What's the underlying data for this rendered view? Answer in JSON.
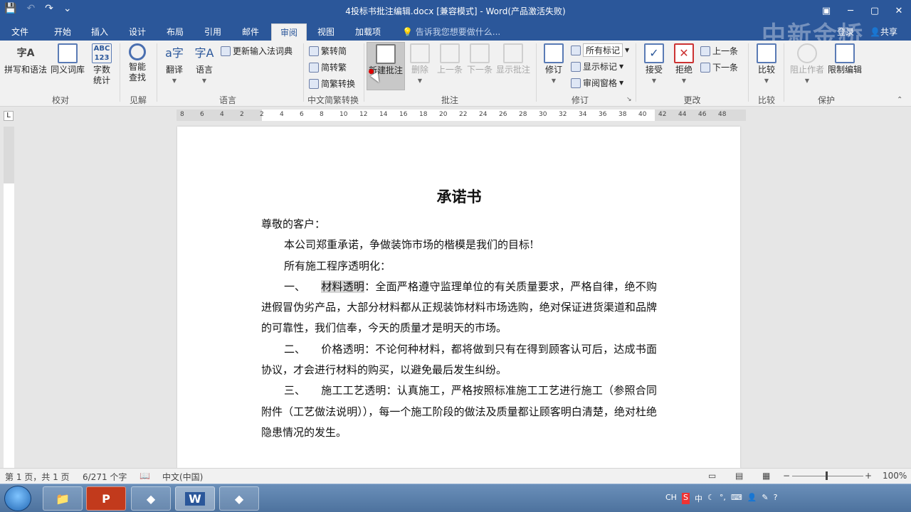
{
  "titlebar": {
    "title": "4投标书批注编辑.docx [兼容模式] - Word(产品激活失败)",
    "save": "💾",
    "undo": "↶",
    "redo": "↷",
    "customize": "⌄",
    "ribbon_opts": "▣",
    "minimize": "─",
    "restore": "▢",
    "close": "✕"
  },
  "tabs": [
    "文件",
    "开始",
    "插入",
    "设计",
    "布局",
    "引用",
    "邮件",
    "审阅",
    "视图",
    "加载项"
  ],
  "active_tab": "审阅",
  "tellme": "告诉我您想要做什么...",
  "signin": "登录",
  "share": "共享",
  "watermark": "中新金桥",
  "ribbon": {
    "spelling": "拼写和语法",
    "thesaurus": "同义词库",
    "wordcount1": "字数",
    "wordcount2": "统计",
    "abc_label": "ABC",
    "abc_num": "123",
    "proofing": "校对",
    "smart1": "智能",
    "smart2": "查找",
    "insights": "见解",
    "translate": "翻译",
    "language": "语言",
    "update_ime": "更新输入法词典",
    "language_group": "语言",
    "t2s": "繁转简",
    "s2t": "简转繁",
    "conv": "简繁转换",
    "chinese_group": "中文简繁转换",
    "new_comment": "新建批注",
    "delete": "删除",
    "prev": "上一条",
    "next": "下一条",
    "show_comments": "显示批注",
    "comments_group": "批注",
    "track": "修订",
    "all_markup": "所有标记",
    "show_markup": "显示标记",
    "review_pane": "审阅窗格",
    "tracking_group": "修订",
    "accept": "接受",
    "reject": "拒绝",
    "prev_change": "上一条",
    "next_change": "下一条",
    "changes_group": "更改",
    "compare": "比较",
    "compare_group": "比较",
    "block_authors": "阻止作者",
    "restrict": "限制编辑",
    "protect_group": "保护"
  },
  "ruler": {
    "ticks": [
      "8",
      "6",
      "4",
      "2",
      "2",
      "4",
      "6",
      "8",
      "10",
      "12",
      "14",
      "16",
      "18",
      "20",
      "22",
      "24",
      "26",
      "28",
      "30",
      "32",
      "34",
      "36",
      "38",
      "40",
      "42",
      "44",
      "46",
      "48"
    ],
    "corner": "L"
  },
  "doc": {
    "title": "承诺书",
    "salutation": "尊敬的客户：",
    "p1": "本公司郑重承诺，争做装饰市场的楷模是我们的目标!",
    "p2": "所有施工程序透明化：",
    "item1_num": "一、",
    "item1_key": "材料透明",
    "item1_rest": "：全面严格遵守监理单位的有关质量要求，严格自律，绝不购进假冒伪劣产品，大部分材料都从正规装饰材料市场选购，绝对保证进货渠道和品牌的可靠性，我们信奉，今天的质量才是明天的市场。",
    "item2_num": "二、",
    "item2_text": "价格透明：不论何种材料，都将做到只有在得到顾客认可后，达成书面协议，才会进行材料的购买，以避免最后发生纠纷。",
    "item3_num": "三、",
    "item3_text": "施工工艺透明：认真施工，严格按照标准施工工艺进行施工（参照合同附件（工艺做法说明）），每一个施工阶段的做法及质量都让顾客明白清楚，绝对杜绝隐患情况的发生。"
  },
  "status": {
    "page": "第 1 页，共 1 页",
    "words": "6/271 个字",
    "lang": "中文(中国)",
    "zoom": "100%",
    "minus": "−",
    "plus": "+"
  },
  "taskbar": {
    "ppt": "P",
    "word": "W",
    "tray": [
      "CH",
      "S",
      "中",
      "☾",
      "°,",
      "⌨",
      "👤",
      "✎",
      "?"
    ]
  },
  "colors": {
    "accent": "#2b579a"
  }
}
